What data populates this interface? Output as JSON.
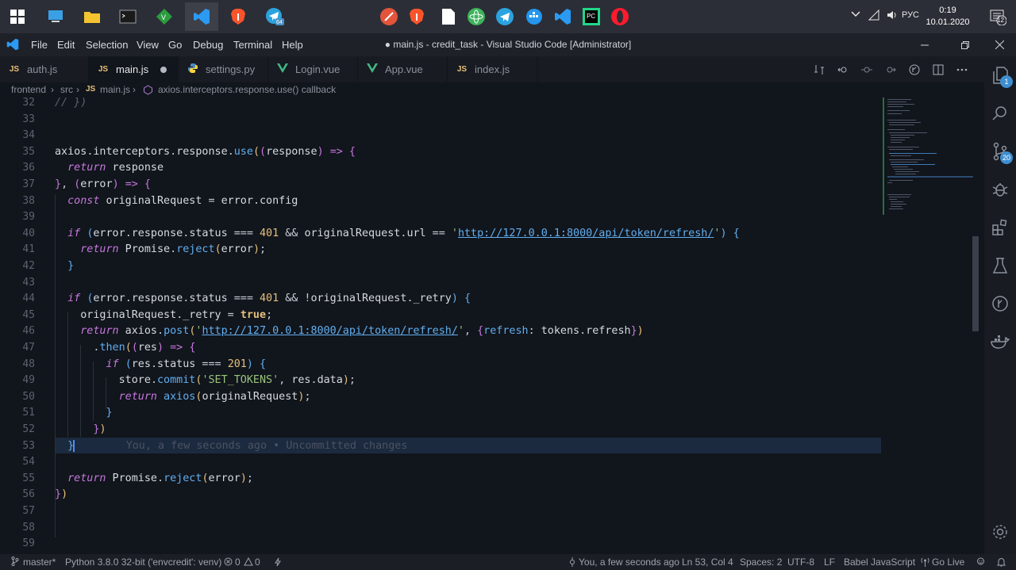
{
  "taskbar": {
    "tray": {
      "language": "РУС",
      "time": "0:19",
      "date": "10.01.2020",
      "notifications_count": "12"
    },
    "badge_vscode_num": "64"
  },
  "window": {
    "title": "● main.js - credit_task - Visual Studio Code [Administrator]",
    "menu": [
      "File",
      "Edit",
      "Selection",
      "View",
      "Go",
      "Debug",
      "Terminal",
      "Help"
    ]
  },
  "tabs": [
    {
      "label": "auth.js",
      "type": "JS"
    },
    {
      "label": "main.js",
      "type": "JS"
    },
    {
      "label": "settings.py",
      "type": "PY"
    },
    {
      "label": "Login.vue",
      "type": "VUE"
    },
    {
      "label": "App.vue",
      "type": "VUE"
    },
    {
      "label": "index.js",
      "type": "JS"
    }
  ],
  "breadcrumb": {
    "part1": "frontend",
    "part2": "src",
    "part3_icon": "JS",
    "part3": "main.js",
    "part4": "axios.interceptors.response.use() callback"
  },
  "editor": {
    "line_numbers": [
      "32",
      "33",
      "34",
      "35",
      "36",
      "37",
      "38",
      "39",
      "40",
      "41",
      "42",
      "43",
      "44",
      "45",
      "46",
      "47",
      "48",
      "49",
      "50",
      "51",
      "52",
      "53",
      "54",
      "55",
      "56",
      "57",
      "58",
      "59"
    ],
    "blame": "You, a few seconds ago • Uncommitted changes",
    "code": {
      "l32": "// })",
      "url": "http://127.0.0.1:8000/api/token/refresh/",
      "status_code": "401",
      "ok_code": "201",
      "mutation": "'SET_TOKENS'"
    }
  },
  "activity": {
    "explorer_badge": "1",
    "scm_badge": "20"
  },
  "statusbar": {
    "branch": "master*",
    "python": "Python 3.8.0 32-bit ('envcredit': venv)",
    "errors": "0",
    "warnings": "0",
    "blame": "You, a few seconds ago",
    "position": "Ln 53, Col 4",
    "spaces": "Spaces: 2",
    "encoding": "UTF-8",
    "eol": "LF",
    "language": "Babel JavaScript",
    "golive": "Go Live"
  }
}
